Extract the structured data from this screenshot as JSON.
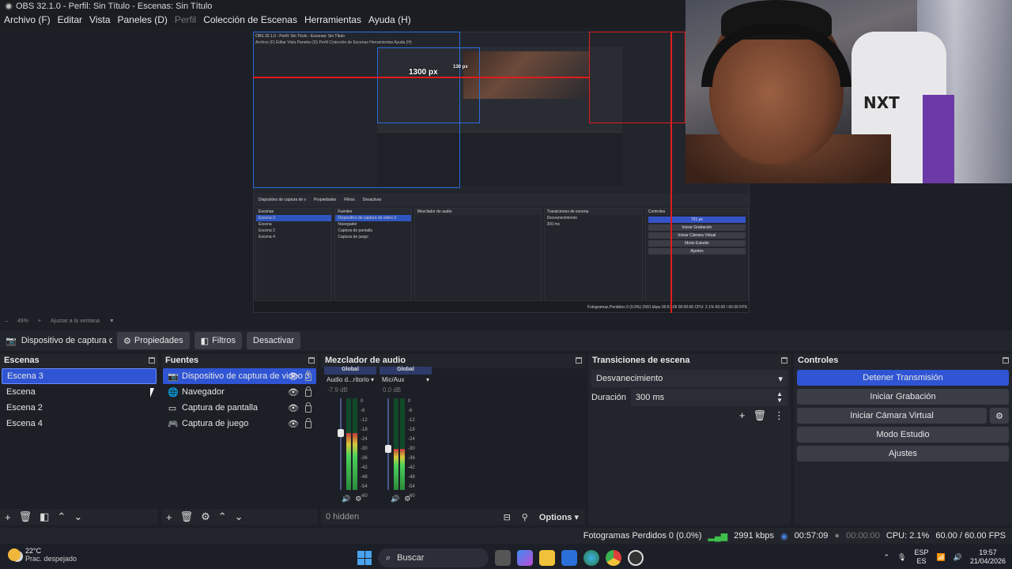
{
  "window": {
    "title": "OBS 32.1.0 - Perfil: Sin Título - Escenas: Sin Título"
  },
  "menu": [
    {
      "label": "Archivo (F)"
    },
    {
      "label": "Editar"
    },
    {
      "label": "Vista"
    },
    {
      "label": "Paneles (D)"
    },
    {
      "label": "Perfil"
    },
    {
      "label": "Colección de Escenas"
    },
    {
      "label": "Herramientas"
    },
    {
      "label": "Ayuda (H)"
    }
  ],
  "preview": {
    "nested_title": "OBS 32.1.0 - Perfil: Sin Título - Escenas: Sin Título",
    "nested_menu": "Archivo (F)   Editar   Vista   Paneles (D)   Perfil   Colección de Escenas   Herramientas   Ayuda (H)",
    "measure_1": "1300 px",
    "measure_2": "731 px",
    "measure_small": "130 px",
    "nested_toolbar": [
      "Dispositivo de captura de v",
      "Propiedades",
      "Filtros",
      "Desactivar"
    ],
    "nested_scenes": [
      "Escena 3",
      "Escena",
      "Escena 2",
      "Escena 4"
    ],
    "nested_sources": [
      "Dispositivo de captura de video 3",
      "Navegador",
      "Captura de pantalla",
      "Captura de juego"
    ],
    "nested_controls": [
      "Iniciar Grabación",
      "Iniciar Cámara Virtual",
      "Modo Estudio",
      "Ajustes"
    ],
    "nested_transition": "Desvanecimiento",
    "nested_duration": "300 ms",
    "nested_status": "Fotogramas Perdidos 0 (0.0%)   2991 kbps   00:57:09   00:00:00   CPU: 2.1%   60.00 / 60.00 FPS",
    "zoom": "49%",
    "fit": "Ajustar a la ventana",
    "webcam_logo": "NXT"
  },
  "source_toolbar": {
    "source_name": "Dispositivo de captura de v",
    "properties": "Propiedades",
    "filters": "Filtros",
    "deactivate": "Desactivar"
  },
  "scenes": {
    "title": "Escenas",
    "items": [
      "Escena 3",
      "Escena",
      "Escena 2",
      "Escena 4"
    ],
    "selected": 0
  },
  "sources": {
    "title": "Fuentes",
    "items": [
      {
        "label": "Dispositivo de captura de video 3",
        "icon": "camera-icon"
      },
      {
        "label": "Navegador",
        "icon": "globe-icon"
      },
      {
        "label": "Captura de pantalla",
        "icon": "monitor-icon"
      },
      {
        "label": "Captura de juego",
        "icon": "gamepad-icon"
      }
    ]
  },
  "mixer": {
    "title": "Mezclador de audio",
    "channels": [
      {
        "global": "Global",
        "name": "Audio d...ritorio",
        "db": "-7.9 dB",
        "level": 0.62
      },
      {
        "global": "Global",
        "name": "Mic/Aux",
        "db": "0.0 dB",
        "level": 0.45
      }
    ],
    "scale": [
      "0",
      "-6",
      "-12",
      "-18",
      "-24",
      "-30",
      "-36",
      "-42",
      "-48",
      "-54",
      "-60"
    ],
    "hidden": "0 hidden",
    "options": "Options"
  },
  "transitions": {
    "title": "Transiciones de escena",
    "current": "Desvanecimiento",
    "duration_label": "Duración",
    "duration_value": "300 ms"
  },
  "controls": {
    "title": "Controles",
    "stop_stream": "Detener Transmisión",
    "start_recording": "Iniciar Grabación",
    "start_virtualcam": "Iniciar Cámara Virtual",
    "studio_mode": "Modo Estudio",
    "settings": "Ajustes"
  },
  "status": {
    "dropped": "Fotogramas Perdidos 0 (0.0%)",
    "bitrate": "2991 kbps",
    "stream_time": "00:57:09",
    "rec_time": "00:00:00",
    "cpu": "CPU: 2.1%",
    "fps": "60.00 / 60.00 FPS"
  },
  "taskbar": {
    "temp": "22°C",
    "weather": "Prac. despejado",
    "search": "Buscar",
    "lang_top": "ESP",
    "lang_bottom": "ES",
    "time": "19:57",
    "date": "21/04/2026"
  },
  "colors": {
    "accent": "#2f55d4",
    "meter_green": "#4bd25a",
    "measure_red": "#e01c1c",
    "bbox_blue": "#2a6bd8"
  }
}
